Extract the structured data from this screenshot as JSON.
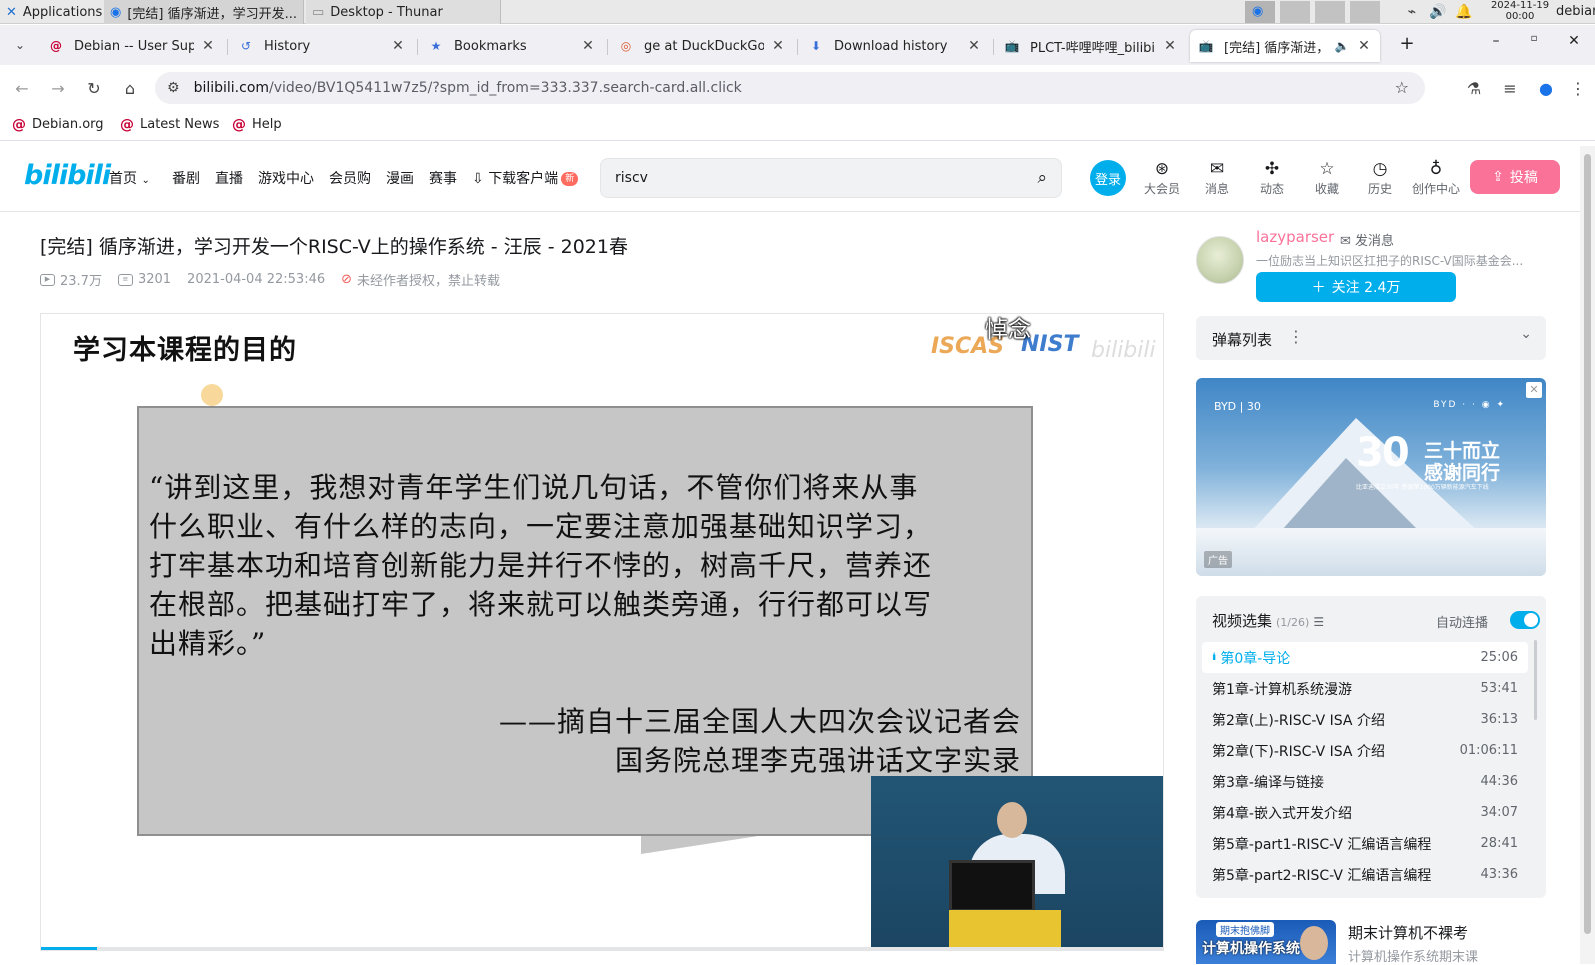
{
  "taskbar": {
    "applications_label": "Applications",
    "windows": [
      {
        "title": "[完结] 循序渐进，学习开发..."
      },
      {
        "title": "Desktop - Thunar"
      }
    ],
    "clock_date": "2024-11-19",
    "clock_time": "00:00",
    "user": "debian"
  },
  "browser": {
    "tabs": [
      {
        "title": "Debian -- User Supp",
        "icon": "debian-swirl-icon"
      },
      {
        "title": "History",
        "icon": "history-icon"
      },
      {
        "title": "Bookmarks",
        "icon": "star-icon"
      },
      {
        "title": "ge at DuckDuckGo",
        "icon": "duckduckgo-icon"
      },
      {
        "title": "Download history",
        "icon": "download-icon"
      },
      {
        "title": "PLCT-哔哩哔哩_bilibi",
        "icon": "bilibili-tv-icon"
      },
      {
        "title": "[完结] 循序渐进，",
        "icon": "bilibili-tv-icon"
      }
    ],
    "url_host": "bilibili.com",
    "url_rest": "/video/BV1Q5411w7z5/?spm_id_from=333.337.search-card.all.click",
    "bookmarks": [
      "Debian.org",
      "Latest News",
      "Help"
    ]
  },
  "bili": {
    "logo": "bilibili",
    "nav": [
      "首页",
      "番剧",
      "直播",
      "游戏中心",
      "会员购",
      "漫画",
      "赛事",
      "下载客户端"
    ],
    "new_badge": "新",
    "search_value": "riscv",
    "login": "登录",
    "icons": [
      "大会员",
      "消息",
      "动态",
      "收藏",
      "历史",
      "创作中心"
    ],
    "upload": "投稿"
  },
  "video": {
    "title": "[完结] 循序渐进，学习开发一个RISC-V上的操作系统 - 汪辰 - 2021春",
    "views": "23.7万",
    "danmaku_count": "3201",
    "date": "2021-04-04 22:53:46",
    "copyright": "未经作者授权，禁止转载"
  },
  "slide": {
    "title": "学习本课程的目的",
    "danmaku": "悼念",
    "logo_left": "ISCAS",
    "logo_right": "NIST",
    "watermark": "bilibili",
    "quote": [
      "“讲到这里，我想对青年学生们说几句话，不管你们将来从事",
      "什么职业、有什么样的志向，一定要注意加强基础知识学习，",
      "打牢基本功和培育创新能力是并行不悖的，树高千尺，营养还",
      "在根部。把基础打牢了，将来就可以触类旁通，行行都可以写",
      "出精彩。”"
    ],
    "source": [
      "——摘自十三届全国人大四次会议记者会",
      "国务院总理李克强讲话文字实录"
    ],
    "progress": 0.05
  },
  "uploader": {
    "name": "lazyparser",
    "message": "发消息",
    "desc": "一位励志当上知识区扛把子的RISC-V国际基金会...",
    "follow": "关注 2.4万"
  },
  "danmaku_panel": {
    "title": "弹幕列表"
  },
  "ad": {
    "number": "30",
    "slogan1": "三十而立",
    "slogan2": "感谢同行",
    "small": "比亚迪成立30年 感谢第1000万辆新能源汽车下线",
    "label": "广告"
  },
  "playlist": {
    "title": "视频选集",
    "count": "(1/26)",
    "auto_label": "自动连播",
    "items": [
      {
        "name": "第0章-导论",
        "duration": "25:06"
      },
      {
        "name": "第1章-计算机系统漫游",
        "duration": "53:41"
      },
      {
        "name": "第2章(上)-RISC-V ISA 介绍",
        "duration": "36:13"
      },
      {
        "name": "第2章(下)-RISC-V ISA 介绍",
        "duration": "01:06:11"
      },
      {
        "name": "第3章-编译与链接",
        "duration": "44:36"
      },
      {
        "name": "第4章-嵌入式开发介绍",
        "duration": "34:07"
      },
      {
        "name": "第5章-part1-RISC-V 汇编语言编程",
        "duration": "28:41"
      },
      {
        "name": "第5章-part2-RISC-V 汇编语言编程",
        "duration": "43:36"
      }
    ]
  },
  "recommend": {
    "thumb_tag": "期末抱佛脚",
    "thumb_text": "计算机操作系统",
    "title": "期末计算机不裸考",
    "sub": "计算机操作系统期末课"
  }
}
